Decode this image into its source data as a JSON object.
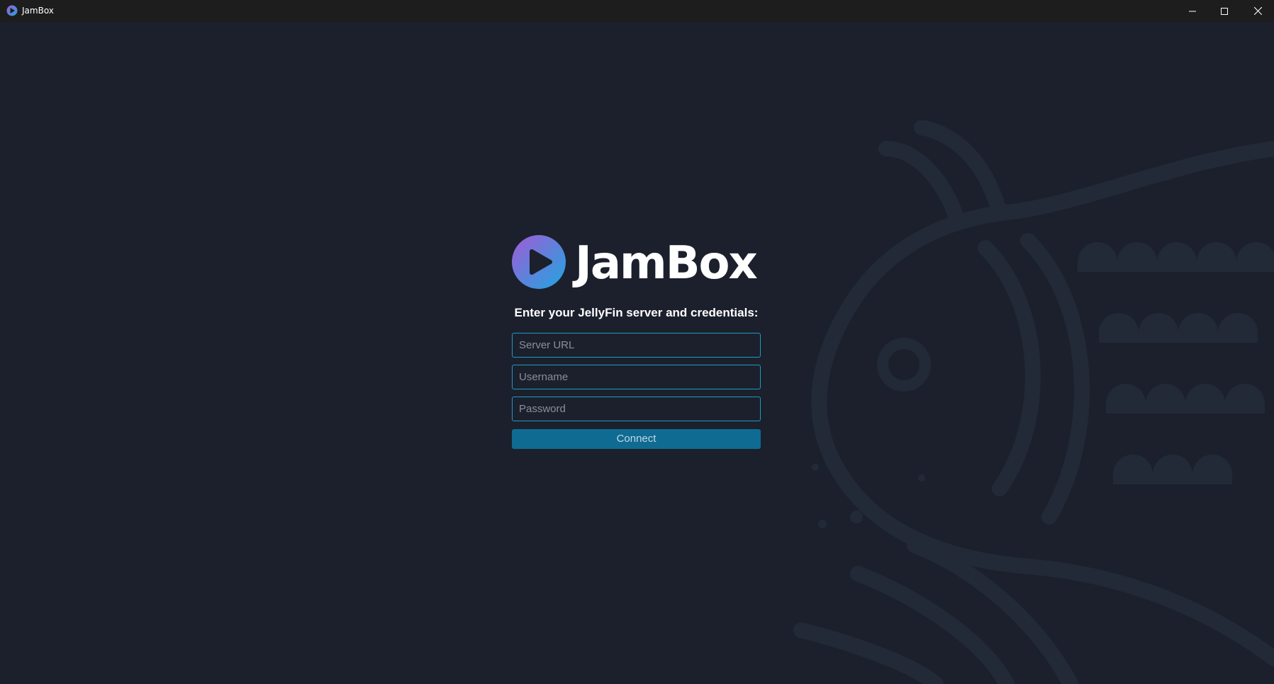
{
  "window": {
    "title": "JamBox",
    "icon": "jambox-play-icon",
    "controls": {
      "minimize": "minimize-icon",
      "maximize": "maximize-icon",
      "close": "close-icon"
    }
  },
  "brand": {
    "name": "JamBox",
    "logo_icon": "play-circle-icon",
    "gradient": [
      "#a25bd6",
      "#1ea6e0"
    ]
  },
  "login": {
    "prompt": "Enter your JellyFin server and credentials:",
    "server_url": {
      "placeholder": "Server URL",
      "value": ""
    },
    "username": {
      "placeholder": "Username",
      "value": ""
    },
    "password": {
      "placeholder": "Password",
      "value": ""
    },
    "connect_label": "Connect"
  },
  "colors": {
    "background": "#1b202c",
    "titlebar": "#1d1d1d",
    "field_border": "#1f9bc4",
    "button": "#0f6b92",
    "art": "#232a37"
  }
}
